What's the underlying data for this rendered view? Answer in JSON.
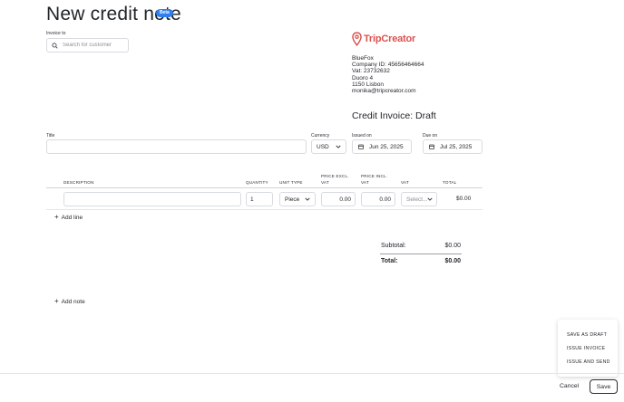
{
  "header": {
    "title": "New credit note",
    "badge": "Beta"
  },
  "invoice_to": {
    "label": "Invoice to",
    "placeholder": "Search for customer"
  },
  "brand": {
    "name": "TripCreator",
    "color": "#d9534f"
  },
  "company": {
    "name": "BlueFox",
    "company_id": "Company ID: 45656464664",
    "vat": "Vat: 23732632",
    "street": "Duoro 4",
    "city": "1150 Lisbon",
    "email": "monika@tripcreator.com"
  },
  "invoice_status": "Credit Invoice: Draft",
  "fields": {
    "title_label": "Title",
    "currency_label": "Currency",
    "currency_value": "USD",
    "issued_label": "Issued on",
    "issued_value": "Jun 25, 2025",
    "due_label": "Due on",
    "due_value": "Jul 25, 2025"
  },
  "table": {
    "columns": {
      "description": "DESCRIPTION",
      "quantity": "QUANTITY",
      "unit_type": "UNIT TYPE",
      "price_excl_1": "PRICE EXCL.",
      "price_excl_2": "VAT",
      "price_incl_1": "PRICE INCL.",
      "price_incl_2": "VAT",
      "vat": "VAT",
      "total": "TOTAL"
    },
    "rows": [
      {
        "description": "",
        "quantity": "1",
        "unit_type": "Piece",
        "price_excl": "0.00",
        "price_incl": "0.00",
        "vat_placeholder": "Select...",
        "total": "$0.00"
      }
    ],
    "add_line": "Add line"
  },
  "totals": {
    "subtotal_label": "Subtotal:",
    "subtotal_value": "$0.00",
    "total_label": "Total:",
    "total_value": "$0.00"
  },
  "add_note": "Add note",
  "menu": {
    "items": [
      "SAVE AS DRAFT",
      "ISSUE INVOICE",
      "ISSUE AND SEND"
    ]
  },
  "footer": {
    "cancel": "Cancel",
    "save": "Save"
  },
  "colors": {
    "accent": "#2f80ed",
    "text": "#1f2328",
    "border": "#d7dbe0"
  }
}
